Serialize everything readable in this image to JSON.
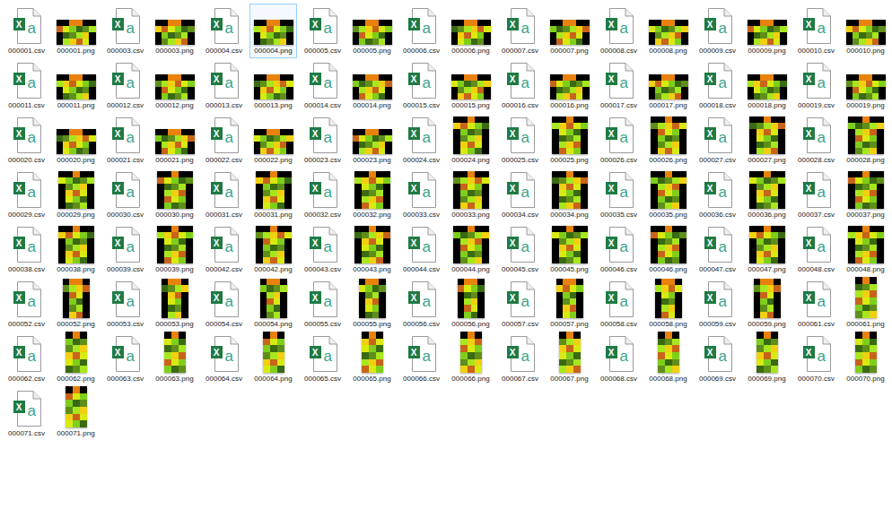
{
  "icon_text": {
    "excel": "X",
    "app": "a"
  },
  "files": [
    {
      "name": "000001.csv",
      "kind": "csv",
      "selected": false
    },
    {
      "name": "000001.png",
      "kind": "wide",
      "selected": false
    },
    {
      "name": "000003.csv",
      "kind": "csv",
      "selected": false
    },
    {
      "name": "000003.png",
      "kind": "wide",
      "selected": false
    },
    {
      "name": "000004.csv",
      "kind": "csv",
      "selected": false
    },
    {
      "name": "000004.png",
      "kind": "wide",
      "selected": true
    },
    {
      "name": "000005.csv",
      "kind": "csv",
      "selected": false
    },
    {
      "name": "000005.png",
      "kind": "wide",
      "selected": false
    },
    {
      "name": "000006.csv",
      "kind": "csv",
      "selected": false
    },
    {
      "name": "000006.png",
      "kind": "wide",
      "selected": false
    },
    {
      "name": "000007.csv",
      "kind": "csv",
      "selected": false
    },
    {
      "name": "000007.png",
      "kind": "wide",
      "selected": false
    },
    {
      "name": "000008.csv",
      "kind": "csv",
      "selected": false
    },
    {
      "name": "000008.png",
      "kind": "wide",
      "selected": false
    },
    {
      "name": "000009.csv",
      "kind": "csv",
      "selected": false
    },
    {
      "name": "000009.png",
      "kind": "wide",
      "selected": false
    },
    {
      "name": "000010.csv",
      "kind": "csv",
      "selected": false
    },
    {
      "name": "000010.png",
      "kind": "wide",
      "selected": false
    },
    {
      "name": "000011.csv",
      "kind": "csv",
      "selected": false
    },
    {
      "name": "000011.png",
      "kind": "wide",
      "selected": false
    },
    {
      "name": "000012.csv",
      "kind": "csv",
      "selected": false
    },
    {
      "name": "000012.png",
      "kind": "wide",
      "selected": false
    },
    {
      "name": "000013.csv",
      "kind": "csv",
      "selected": false
    },
    {
      "name": "000013.png",
      "kind": "wide",
      "selected": false
    },
    {
      "name": "000014.csv",
      "kind": "csv",
      "selected": false
    },
    {
      "name": "000014.png",
      "kind": "wide",
      "selected": false
    },
    {
      "name": "000015.csv",
      "kind": "csv",
      "selected": false
    },
    {
      "name": "000015.png",
      "kind": "wide",
      "selected": false
    },
    {
      "name": "000016.csv",
      "kind": "csv",
      "selected": false
    },
    {
      "name": "000016.png",
      "kind": "wide",
      "selected": false
    },
    {
      "name": "000017.csv",
      "kind": "csv",
      "selected": false
    },
    {
      "name": "000017.png",
      "kind": "wide",
      "selected": false
    },
    {
      "name": "000018.csv",
      "kind": "csv",
      "selected": false
    },
    {
      "name": "000018.png",
      "kind": "wide",
      "selected": false
    },
    {
      "name": "000019.csv",
      "kind": "csv",
      "selected": false
    },
    {
      "name": "000019.png",
      "kind": "wide",
      "selected": false
    },
    {
      "name": "000020.csv",
      "kind": "csv",
      "selected": false
    },
    {
      "name": "000020.png",
      "kind": "wide",
      "selected": false
    },
    {
      "name": "000021.csv",
      "kind": "csv",
      "selected": false
    },
    {
      "name": "000021.png",
      "kind": "wide",
      "selected": false
    },
    {
      "name": "000022.csv",
      "kind": "csv",
      "selected": false
    },
    {
      "name": "000022.png",
      "kind": "wide",
      "selected": false
    },
    {
      "name": "000023.csv",
      "kind": "csv",
      "selected": false
    },
    {
      "name": "000023.png",
      "kind": "wide",
      "selected": false
    },
    {
      "name": "000024.csv",
      "kind": "csv",
      "selected": false
    },
    {
      "name": "000024.png",
      "kind": "square",
      "selected": false
    },
    {
      "name": "000025.csv",
      "kind": "csv",
      "selected": false
    },
    {
      "name": "000025.png",
      "kind": "square",
      "selected": false
    },
    {
      "name": "000026.csv",
      "kind": "csv",
      "selected": false
    },
    {
      "name": "000026.png",
      "kind": "square",
      "selected": false
    },
    {
      "name": "000027.csv",
      "kind": "csv",
      "selected": false
    },
    {
      "name": "000027.png",
      "kind": "square",
      "selected": false
    },
    {
      "name": "000028.csv",
      "kind": "csv",
      "selected": false
    },
    {
      "name": "000028.png",
      "kind": "square",
      "selected": false
    },
    {
      "name": "000029.csv",
      "kind": "csv",
      "selected": false
    },
    {
      "name": "000029.png",
      "kind": "square",
      "selected": false
    },
    {
      "name": "000030.csv",
      "kind": "csv",
      "selected": false
    },
    {
      "name": "000030.png",
      "kind": "square",
      "selected": false
    },
    {
      "name": "000031.csv",
      "kind": "csv",
      "selected": false
    },
    {
      "name": "000031.png",
      "kind": "square",
      "selected": false
    },
    {
      "name": "000032.csv",
      "kind": "csv",
      "selected": false
    },
    {
      "name": "000032.png",
      "kind": "square",
      "selected": false
    },
    {
      "name": "000033.csv",
      "kind": "csv",
      "selected": false
    },
    {
      "name": "000033.png",
      "kind": "square",
      "selected": false
    },
    {
      "name": "000034.csv",
      "kind": "csv",
      "selected": false
    },
    {
      "name": "000034.png",
      "kind": "square",
      "selected": false
    },
    {
      "name": "000035.csv",
      "kind": "csv",
      "selected": false
    },
    {
      "name": "000035.png",
      "kind": "square",
      "selected": false
    },
    {
      "name": "000036.csv",
      "kind": "csv",
      "selected": false
    },
    {
      "name": "000036.png",
      "kind": "square",
      "selected": false
    },
    {
      "name": "000037.csv",
      "kind": "csv",
      "selected": false
    },
    {
      "name": "000037.png",
      "kind": "square",
      "selected": false
    },
    {
      "name": "000038.csv",
      "kind": "csv",
      "selected": false
    },
    {
      "name": "000038.png",
      "kind": "square",
      "selected": false
    },
    {
      "name": "000039.csv",
      "kind": "csv",
      "selected": false
    },
    {
      "name": "000039.png",
      "kind": "square",
      "selected": false
    },
    {
      "name": "000042.csv",
      "kind": "csv",
      "selected": false
    },
    {
      "name": "000042.png",
      "kind": "square",
      "selected": false
    },
    {
      "name": "000043.csv",
      "kind": "csv",
      "selected": false
    },
    {
      "name": "000043.png",
      "kind": "square",
      "selected": false
    },
    {
      "name": "000044.csv",
      "kind": "csv",
      "selected": false
    },
    {
      "name": "000044.png",
      "kind": "square",
      "selected": false
    },
    {
      "name": "000045.csv",
      "kind": "csv",
      "selected": false
    },
    {
      "name": "000045.png",
      "kind": "square",
      "selected": false
    },
    {
      "name": "000046.csv",
      "kind": "csv",
      "selected": false
    },
    {
      "name": "000046.png",
      "kind": "square",
      "selected": false
    },
    {
      "name": "000047.csv",
      "kind": "csv",
      "selected": false
    },
    {
      "name": "000047.png",
      "kind": "square",
      "selected": false
    },
    {
      "name": "000048.csv",
      "kind": "csv",
      "selected": false
    },
    {
      "name": "000048.png",
      "kind": "square",
      "selected": false
    },
    {
      "name": "000052.csv",
      "kind": "csv",
      "selected": false
    },
    {
      "name": "000052.png",
      "kind": "tall",
      "selected": false
    },
    {
      "name": "000053.csv",
      "kind": "csv",
      "selected": false
    },
    {
      "name": "000053.png",
      "kind": "tall",
      "selected": false
    },
    {
      "name": "000054.csv",
      "kind": "csv",
      "selected": false
    },
    {
      "name": "000054.png",
      "kind": "tall",
      "selected": false
    },
    {
      "name": "000055.csv",
      "kind": "csv",
      "selected": false
    },
    {
      "name": "000055.png",
      "kind": "tall",
      "selected": false
    },
    {
      "name": "000056.csv",
      "kind": "csv",
      "selected": false
    },
    {
      "name": "000056.png",
      "kind": "tall",
      "selected": false
    },
    {
      "name": "000057.csv",
      "kind": "csv",
      "selected": false
    },
    {
      "name": "000057.png",
      "kind": "tall",
      "selected": false
    },
    {
      "name": "000058.csv",
      "kind": "csv",
      "selected": false
    },
    {
      "name": "000058.png",
      "kind": "tall",
      "selected": false
    },
    {
      "name": "000059.csv",
      "kind": "csv",
      "selected": false
    },
    {
      "name": "000059.png",
      "kind": "tall",
      "selected": false
    },
    {
      "name": "000061.csv",
      "kind": "csv",
      "selected": false
    },
    {
      "name": "000061.png",
      "kind": "narrow",
      "selected": false
    },
    {
      "name": "000062.csv",
      "kind": "csv",
      "selected": false
    },
    {
      "name": "000062.png",
      "kind": "narrow",
      "selected": false
    },
    {
      "name": "000063.csv",
      "kind": "csv",
      "selected": false
    },
    {
      "name": "000063.png",
      "kind": "narrow",
      "selected": false
    },
    {
      "name": "000064.csv",
      "kind": "csv",
      "selected": false
    },
    {
      "name": "000064.png",
      "kind": "narrow",
      "selected": false
    },
    {
      "name": "000065.csv",
      "kind": "csv",
      "selected": false
    },
    {
      "name": "000065.png",
      "kind": "narrow",
      "selected": false
    },
    {
      "name": "000066.csv",
      "kind": "csv",
      "selected": false
    },
    {
      "name": "000066.png",
      "kind": "narrow",
      "selected": false
    },
    {
      "name": "000067.csv",
      "kind": "csv",
      "selected": false
    },
    {
      "name": "000067.png",
      "kind": "narrow",
      "selected": false
    },
    {
      "name": "000068.csv",
      "kind": "csv",
      "selected": false
    },
    {
      "name": "000068.png",
      "kind": "narrow",
      "selected": false
    },
    {
      "name": "000069.csv",
      "kind": "csv",
      "selected": false
    },
    {
      "name": "000069.png",
      "kind": "narrow",
      "selected": false
    },
    {
      "name": "000070.csv",
      "kind": "csv",
      "selected": false
    },
    {
      "name": "000070.png",
      "kind": "narrow",
      "selected": false
    },
    {
      "name": "000071.csv",
      "kind": "csv",
      "selected": false
    },
    {
      "name": "000071.png",
      "kind": "narrow",
      "selected": false
    }
  ]
}
